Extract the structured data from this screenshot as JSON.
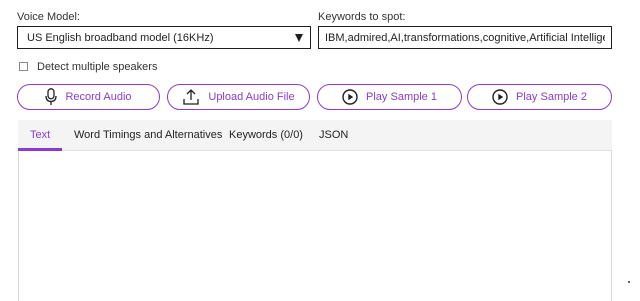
{
  "voice_model": {
    "label": "Voice Model:",
    "selected": "US English broadband model (16KHz)"
  },
  "keywords": {
    "label": "Keywords to spot:",
    "value": "IBM,admired,AI,transformations,cognitive,Artificial Intelligence,da"
  },
  "detect_speakers": {
    "label": "Detect multiple speakers",
    "checked": false
  },
  "buttons": {
    "record": "Record Audio",
    "upload": "Upload Audio File",
    "sample1": "Play Sample 1",
    "sample2": "Play Sample 2"
  },
  "tabs": {
    "text": "Text",
    "word_timings": "Word Timings and Alternatives",
    "keywords": "Keywords (0/0)",
    "json": "JSON",
    "active": "text"
  },
  "icons": {
    "record": "microphone-icon",
    "upload": "upload-icon",
    "sample1": "play-circle-icon",
    "sample2": "play-circle-icon"
  },
  "colors": {
    "accent": "#8b3ccf",
    "tab_bar": "#f4f4f4",
    "border": "#1f1f1f"
  }
}
